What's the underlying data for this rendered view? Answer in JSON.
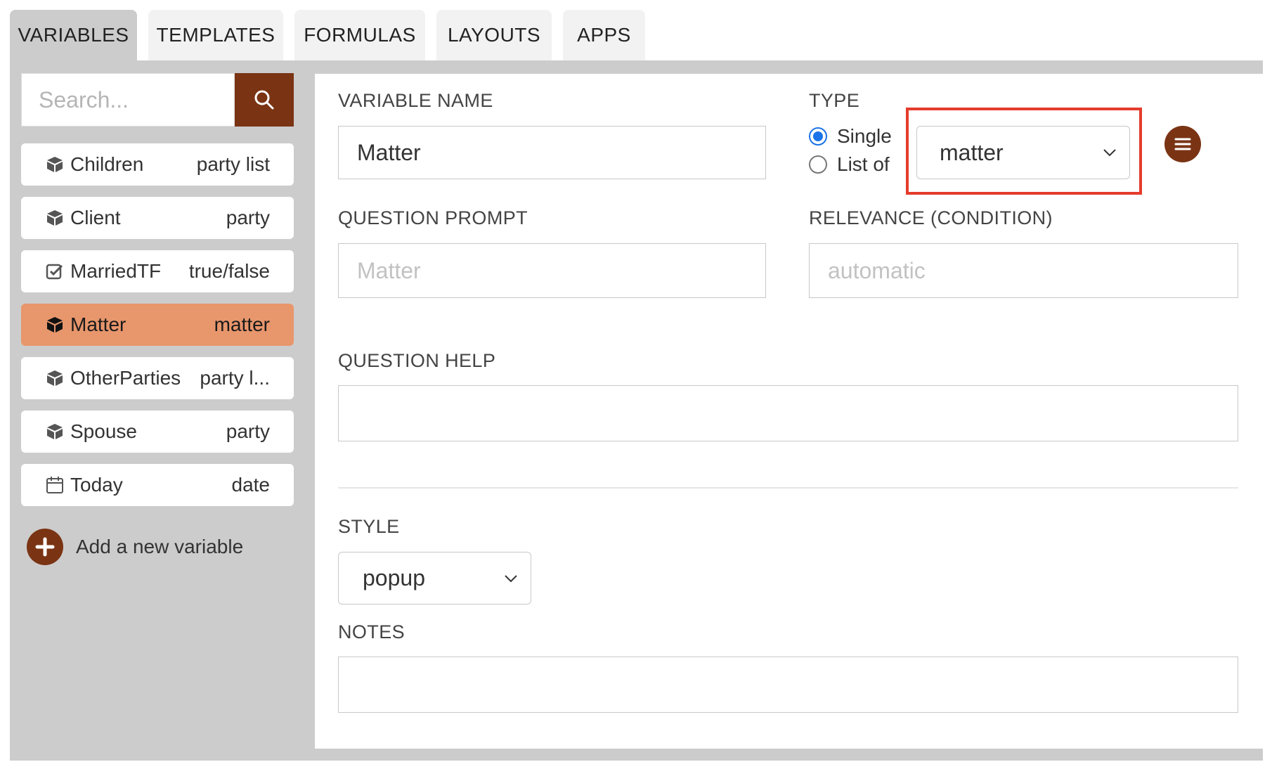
{
  "tabs": [
    {
      "label": "VARIABLES",
      "active": true
    },
    {
      "label": "TEMPLATES",
      "active": false
    },
    {
      "label": "FORMULAS",
      "active": false
    },
    {
      "label": "LAYOUTS",
      "active": false
    },
    {
      "label": "APPS",
      "active": false
    }
  ],
  "sidebar": {
    "search_placeholder": "Search...",
    "variables": [
      {
        "name": "Children",
        "type": "party list",
        "icon": "cube-icon"
      },
      {
        "name": "Client",
        "type": "party",
        "icon": "cube-icon"
      },
      {
        "name": "MarriedTF",
        "type": "true/false",
        "icon": "checkbox-icon"
      },
      {
        "name": "Matter",
        "type": "matter",
        "icon": "cube-icon",
        "selected": true
      },
      {
        "name": "OtherParties",
        "type": "party l...",
        "icon": "cube-icon"
      },
      {
        "name": "Spouse",
        "type": "party",
        "icon": "cube-icon"
      },
      {
        "name": "Today",
        "type": "date",
        "icon": "calendar-icon"
      }
    ],
    "add_label": "Add a new variable"
  },
  "form": {
    "variable_name_label": "VARIABLE NAME",
    "variable_name_value": "Matter",
    "type_label": "TYPE",
    "type_option_single": "Single",
    "type_option_list": "List of",
    "type_selected_option": "Single",
    "type_select_value": "matter",
    "question_prompt_label": "QUESTION PROMPT",
    "question_prompt_placeholder": "Matter",
    "relevance_label": "RELEVANCE (CONDITION)",
    "relevance_placeholder": "automatic",
    "question_help_label": "QUESTION HELP",
    "style_label": "STYLE",
    "style_value": "popup",
    "notes_label": "NOTES"
  },
  "colors": {
    "accent_brown": "#7a3414",
    "selected_row": "#e8966c",
    "highlight_red": "#e53c2c",
    "radio_blue": "#1a73e8",
    "panel_gray": "#cccccc"
  }
}
